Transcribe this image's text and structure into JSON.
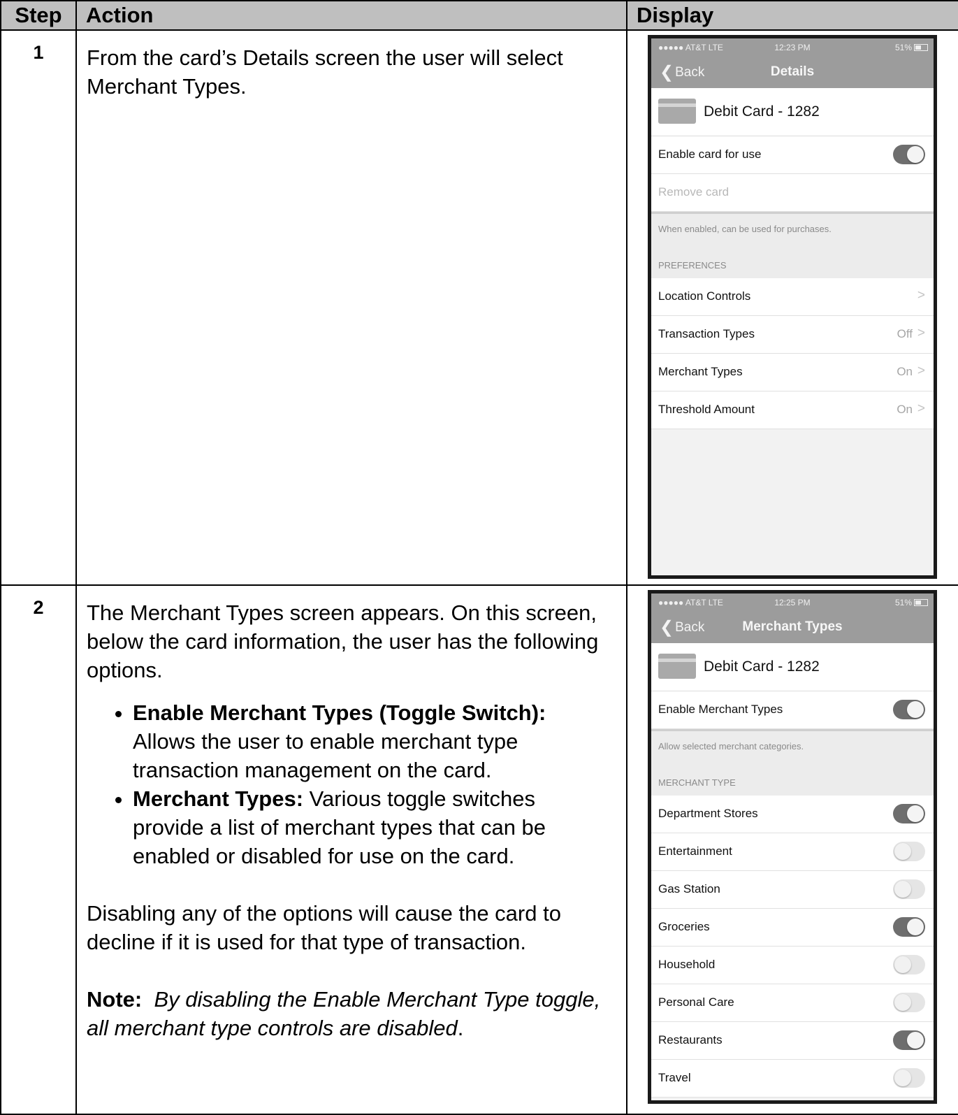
{
  "headers": {
    "step": "Step",
    "action": "Action",
    "display": "Display"
  },
  "step1": {
    "number": "1",
    "text": "From the card’s Details screen the user will select Merchant Types.",
    "phone": {
      "status": {
        "carrier": "●●●●● AT&T  LTE",
        "time": "12:23 PM",
        "battery": "51%"
      },
      "nav": {
        "back": "Back",
        "title": "Details"
      },
      "card_label": "Debit Card - 1282",
      "enable_label": "Enable card for use",
      "enable_on": true,
      "remove_label": "Remove card",
      "note": "When enabled, can be used for purchases.",
      "section": "PREFERENCES",
      "prefs": [
        {
          "label": "Location Controls",
          "value": ""
        },
        {
          "label": "Transaction Types",
          "value": "Off"
        },
        {
          "label": "Merchant Types",
          "value": "On"
        },
        {
          "label": "Threshold Amount",
          "value": "On"
        }
      ]
    }
  },
  "step2": {
    "number": "2",
    "intro": "The Merchant Types screen appears.  On this screen, below the card information, the user has the following options.",
    "bullets": [
      {
        "term": "Enable Merchant Types (Toggle Switch):",
        "desc": "Allows the user to enable merchant type transaction management on the card."
      },
      {
        "term": "Merchant Types:",
        "desc": " Various toggle switches provide a list of merchant types that can be enabled or disabled for use on the card."
      }
    ],
    "paragraph": "Disabling any of the options will cause the card to decline if it is used for that type of transaction.",
    "note_label": "Note:",
    "note_text": "By disabling the Enable Merchant Type toggle, all merchant type controls are disabled",
    "note_end": ".",
    "phone": {
      "status": {
        "carrier": "●●●●● AT&T  LTE",
        "time": "12:25 PM",
        "battery": "51%"
      },
      "nav": {
        "back": "Back",
        "title": "Merchant Types"
      },
      "card_label": "Debit Card - 1282",
      "enable_label": "Enable Merchant Types",
      "enable_on": true,
      "note": "Allow selected merchant categories.",
      "section": "MERCHANT TYPE",
      "merchants": [
        {
          "label": "Department Stores",
          "on": true
        },
        {
          "label": "Entertainment",
          "on": false
        },
        {
          "label": "Gas Station",
          "on": false
        },
        {
          "label": "Groceries",
          "on": true
        },
        {
          "label": "Household",
          "on": false
        },
        {
          "label": "Personal Care",
          "on": false
        },
        {
          "label": "Restaurants",
          "on": true
        },
        {
          "label": "Travel",
          "on": false
        }
      ]
    }
  }
}
